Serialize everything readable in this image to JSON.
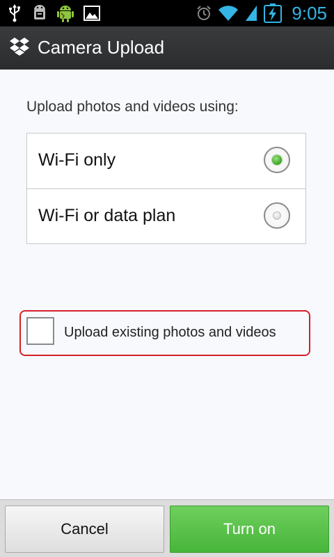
{
  "status_bar": {
    "time": "9:05",
    "icons": [
      "usb-icon",
      "android-debug-icon",
      "android-icon",
      "image-icon",
      "alarm-icon",
      "wifi-icon",
      "signal-icon",
      "battery-charging-icon"
    ]
  },
  "title_bar": {
    "title": "Camera Upload",
    "logo": "dropbox-icon"
  },
  "content": {
    "prompt": "Upload photos and videos using:",
    "options": [
      {
        "label": "Wi-Fi only",
        "selected": true
      },
      {
        "label": "Wi-Fi or data plan",
        "selected": false
      }
    ],
    "checkbox_label": "Upload existing photos and videos",
    "checkbox_checked": false
  },
  "buttons": {
    "cancel": "Cancel",
    "turn_on": "Turn on"
  },
  "colors": {
    "accent_green": "#4cba3d",
    "highlight_red": "#d4202a",
    "status_blue": "#33b5e5"
  }
}
